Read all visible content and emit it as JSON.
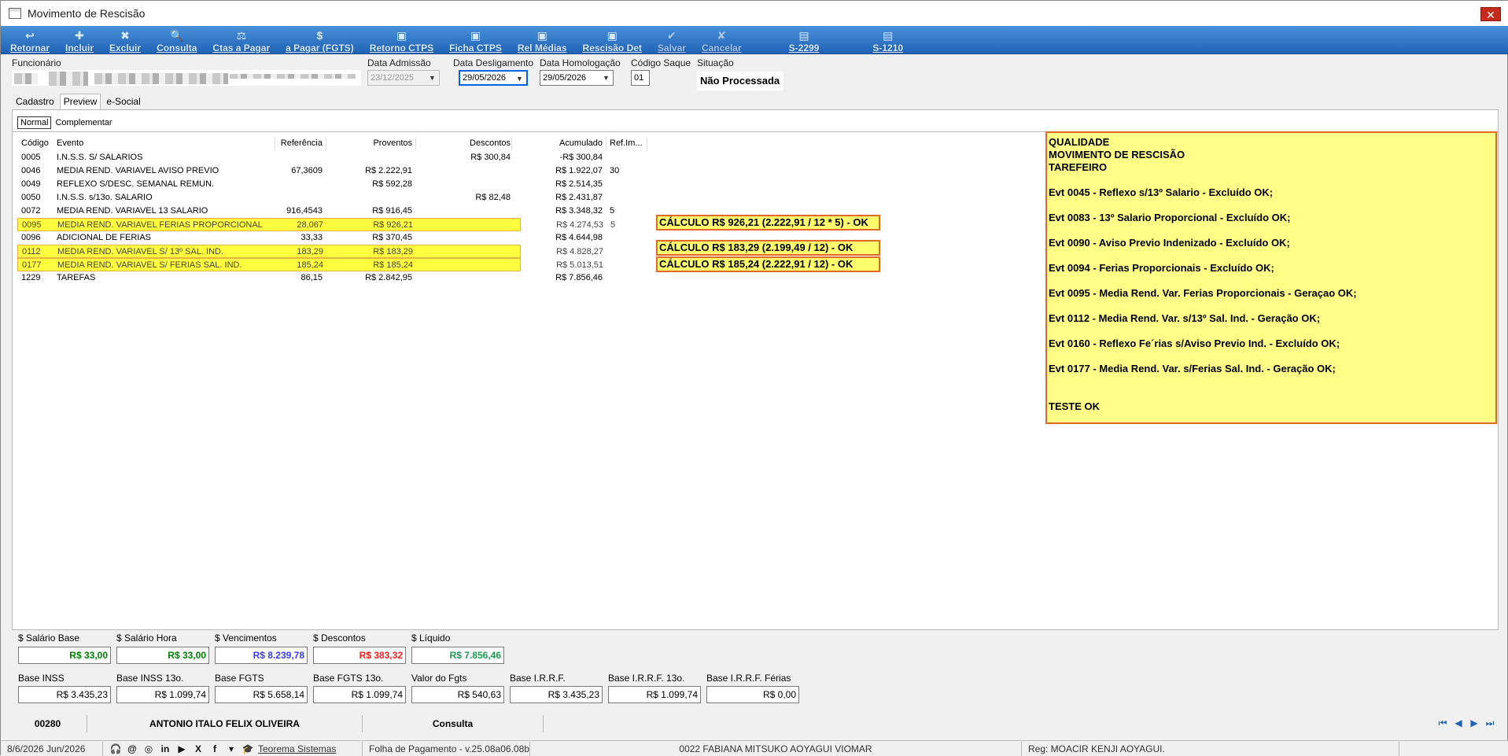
{
  "window": {
    "title": "Movimento de Rescisão",
    "close_label": "✕"
  },
  "toolbar": [
    {
      "label": "Retornar",
      "icon": "↩"
    },
    {
      "label": "Incluir",
      "icon": "✚"
    },
    {
      "label": "Excluir",
      "icon": "✖"
    },
    {
      "label": "Consulta",
      "icon": "🔍"
    },
    {
      "label": "Ctas a Pagar",
      "icon": "⚖"
    },
    {
      "label": "a Pagar (FGTS)",
      "icon": "$"
    },
    {
      "label": "Retorno CTPS",
      "icon": "▣"
    },
    {
      "label": "Ficha CTPS",
      "icon": "▣"
    },
    {
      "label": "Rel Médias",
      "icon": "▣"
    },
    {
      "label": "Rescisão Det",
      "icon": "▣"
    },
    {
      "label": "Salvar",
      "icon": "✔"
    },
    {
      "label": "Cancelar",
      "icon": "✘"
    },
    {
      "label": "S-2299",
      "icon": "▤"
    },
    {
      "label": "S-1210",
      "icon": "▤"
    }
  ],
  "header": {
    "funcionario_label": "Funcionário",
    "admissao_label": "Data Admissão",
    "admissao_value": "23/12/2025",
    "desligamento_label": "Data Desligamento",
    "desligamento_value": "29/05/2026",
    "homologacao_label": "Data Homologação",
    "homologacao_value": "29/05/2026",
    "codigo_saque_label": "Código Saque",
    "codigo_saque_value": "01",
    "situacao_label": "Situação",
    "situacao_value": "Não Processada"
  },
  "tabs": [
    "Cadastro",
    "Preview",
    "e-Social"
  ],
  "subtabs": [
    "Normal",
    "Complementar"
  ],
  "grid": {
    "columns": [
      "Código",
      "Evento",
      "Referência",
      "Proventos",
      "Descontos",
      "Acumulado",
      "Ref.Im..."
    ],
    "rows": [
      {
        "cod": "0005",
        "evt": "I.N.S.S. S/ SALARIOS",
        "ref": "",
        "pro": "",
        "des": "R$ 300,84",
        "acu": "-R$ 300,84",
        "rfi": "",
        "hl": false
      },
      {
        "cod": "0046",
        "evt": "MEDIA REND. VARIAVEL AVISO PREVIO",
        "ref": "67,3609",
        "pro": "R$ 2.222,91",
        "des": "",
        "acu": "R$ 1.922,07",
        "rfi": "30",
        "hl": false
      },
      {
        "cod": "0049",
        "evt": "REFLEXO S/DESC. SEMANAL REMUN.",
        "ref": "",
        "pro": "R$ 592,28",
        "des": "",
        "acu": "R$ 2.514,35",
        "rfi": "",
        "hl": false
      },
      {
        "cod": "0050",
        "evt": "I.N.S.S. s/13o. SALARIO",
        "ref": "",
        "pro": "",
        "des": "R$ 82,48",
        "acu": "R$ 2.431,87",
        "rfi": "",
        "hl": false
      },
      {
        "cod": "0072",
        "evt": "MEDIA REND. VARIAVEL 13 SALARIO",
        "ref": "916,4543",
        "pro": "R$ 916,45",
        "des": "",
        "acu": "R$ 3.348,32",
        "rfi": "5",
        "hl": false
      },
      {
        "cod": "0095",
        "evt": "MEDIA REND. VARIAVEL FERIAS PROPORCIONAL",
        "ref": "28,067",
        "pro": "R$ 926,21",
        "des": "",
        "acu": "R$ 4.274,53",
        "rfi": "5",
        "hl": true
      },
      {
        "cod": "0096",
        "evt": "ADICIONAL DE FERIAS",
        "ref": "33,33",
        "pro": "R$ 370,45",
        "des": "",
        "acu": "R$ 4.644,98",
        "rfi": "",
        "hl": false
      },
      {
        "cod": "0112",
        "evt": "MEDIA REND. VARIAVEL S/ 13º SAL. IND.",
        "ref": "183,29",
        "pro": "R$ 183,29",
        "des": "",
        "acu": "R$ 4.828,27",
        "rfi": "",
        "hl": true
      },
      {
        "cod": "0177",
        "evt": "MEDIA REND. VARIAVEL S/ FERIAS SAL. IND.",
        "ref": "185,24",
        "pro": "R$ 185,24",
        "des": "",
        "acu": "R$ 5.013,51",
        "rfi": "",
        "hl": true
      },
      {
        "cod": "1229",
        "evt": "TAREFAS",
        "ref": "86,15",
        "pro": "R$ 2.842,95",
        "des": "",
        "acu": "R$ 7.856,46",
        "rfi": "",
        "hl": false
      }
    ]
  },
  "calc_notes": [
    "CÁLCULO R$  926,21 (2.222,91 / 12 * 5) - OK",
    "CÁLCULO R$  183,29 (2.199,49  / 12) - OK",
    "CÁLCULO R$  185,24 (2.222,91 / 12) - OK"
  ],
  "notes": [
    "QUALIDADE",
    "MOVIMENTO DE RESCISÃO",
    "TAREFEIRO",
    "",
    "Evt 0045 - Reflexo s/13º Salario - Excluído OK;",
    "",
    "Evt 0083 - 13º Salario Proporcional - Excluído OK;",
    "",
    "Evt 0090 - Aviso Previo Indenizado - Excluído OK;",
    "",
    "Evt 0094 - Ferias Proporcionais - Excluído OK;",
    "",
    "Evt 0095 - Media Rend. Var. Ferias Proporcionais - Geraçao OK;",
    "",
    "Evt 0112 - Media Rend. Var. s/13º Sal. Ind. - Geração OK;",
    "",
    "Evt 0160 - Reflexo Fe´rias s/Aviso Previo Ind. - Excluído OK;",
    "",
    "Evt 0177 - Media Rend. Var. s/Ferias Sal. Ind. - Geração OK;",
    "",
    "",
    "TESTE OK"
  ],
  "totals_row1": [
    {
      "label": "$ Salário Base",
      "value": "R$ 33,00",
      "color": "#008000"
    },
    {
      "label": "$ Salário Hora",
      "value": "R$ 33,00",
      "color": "#008000"
    },
    {
      "label": "$ Vencimentos",
      "value": "R$ 8.239,78",
      "color": "#3b3bff"
    },
    {
      "label": "$ Descontos",
      "value": "R$ 383,32",
      "color": "#ff2020"
    },
    {
      "label": "$ Líquido",
      "value": "R$ 7.856,46",
      "color": "#1a9a50"
    }
  ],
  "totals_row2": [
    {
      "label": "Base INSS",
      "value": "R$ 3.435,23"
    },
    {
      "label": "Base INSS 13o.",
      "value": "R$ 1.099,74"
    },
    {
      "label": "Base FGTS",
      "value": "R$ 5.658,14"
    },
    {
      "label": "Base FGTS 13o.",
      "value": "R$ 1.099,74"
    },
    {
      "label": "Valor do Fgts",
      "value": "R$ 540,63"
    },
    {
      "label": "Base I.R.R.F.",
      "value": "R$ 3.435,23"
    },
    {
      "label": "Base I.R.R.F. 13o.",
      "value": "R$ 1.099,74"
    },
    {
      "label": "Base I.R.R.F. Férias",
      "value": "R$ 0,00"
    }
  ],
  "status_strip": {
    "code": "00280",
    "name": "ANTONIO ITALO FELIX OLIVEIRA",
    "mode": "Consulta"
  },
  "statusbar": {
    "date": "8/6/2026 Jun/2026",
    "company_link": "Teorema Sistemas",
    "version": "Folha de Pagamento - v.25.08a06.08b",
    "user": "0022 FABIANA MITSUKO AOYAGUI VIOMAR",
    "reg": "Reg: MOACIR KENJI AOYAGUI."
  }
}
